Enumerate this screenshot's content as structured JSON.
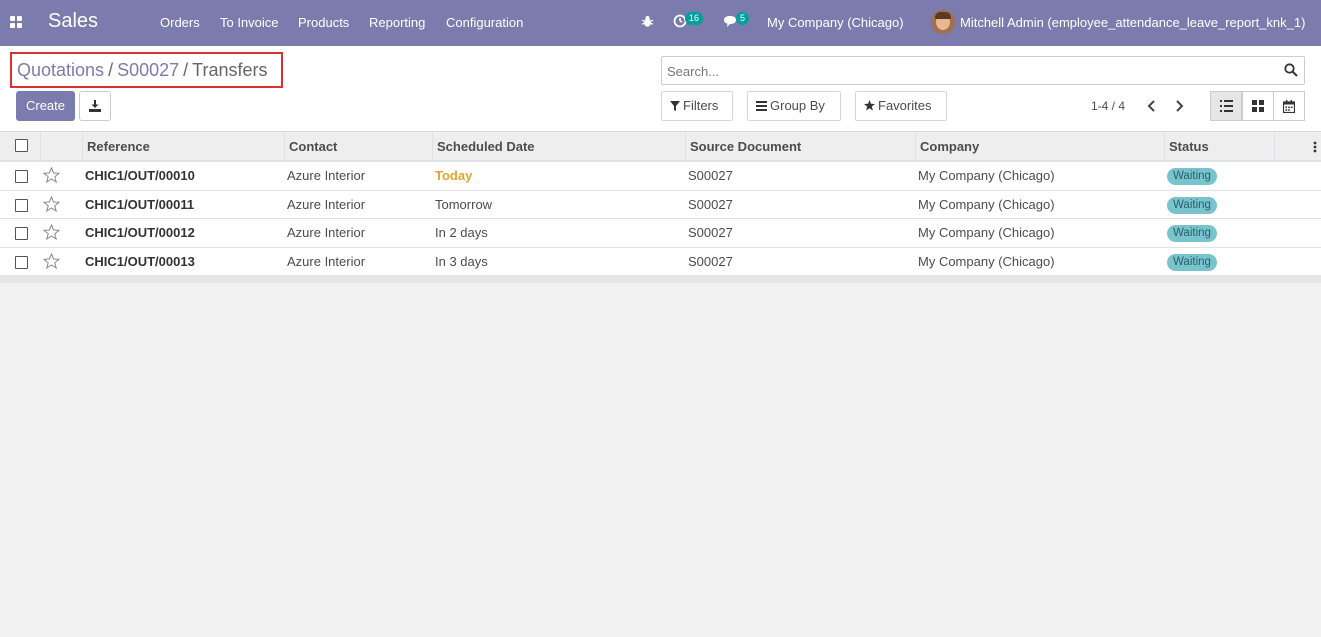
{
  "app": {
    "name": "Sales",
    "menu": [
      "Orders",
      "To Invoice",
      "Products",
      "Reporting",
      "Configuration"
    ],
    "activity_count": "16",
    "message_count": "5",
    "company": "My Company (Chicago)",
    "user": "Mitchell Admin (employee_attendance_leave_report_knk_1)"
  },
  "breadcrumb": {
    "items": [
      "Quotations",
      "S00027"
    ],
    "current": "Transfers"
  },
  "actions": {
    "create_label": "Create"
  },
  "search": {
    "placeholder": "Search..."
  },
  "filters": {
    "filters_label": "Filters",
    "groupby_label": "Group By",
    "favorites_label": "Favorites"
  },
  "pager": {
    "value": "1-4 / 4"
  },
  "table": {
    "columns": [
      "Reference",
      "Contact",
      "Scheduled Date",
      "Source Document",
      "Company",
      "Status"
    ],
    "rows": [
      {
        "reference": "CHIC1/OUT/00010",
        "contact": "Azure Interior",
        "scheduled": "Today",
        "source": "S00027",
        "company": "My Company (Chicago)",
        "status": "Waiting"
      },
      {
        "reference": "CHIC1/OUT/00011",
        "contact": "Azure Interior",
        "scheduled": "Tomorrow",
        "source": "S00027",
        "company": "My Company (Chicago)",
        "status": "Waiting"
      },
      {
        "reference": "CHIC1/OUT/00012",
        "contact": "Azure Interior",
        "scheduled": "In 2 days",
        "source": "S00027",
        "company": "My Company (Chicago)",
        "status": "Waiting"
      },
      {
        "reference": "CHIC1/OUT/00013",
        "contact": "Azure Interior",
        "scheduled": "In 3 days",
        "source": "S00027",
        "company": "My Company (Chicago)",
        "status": "Waiting"
      }
    ]
  },
  "colors": {
    "brand": "#7c7bad",
    "today": "#e3a32c",
    "status_waiting": "#77c4cf",
    "badge": "#00a09d"
  }
}
